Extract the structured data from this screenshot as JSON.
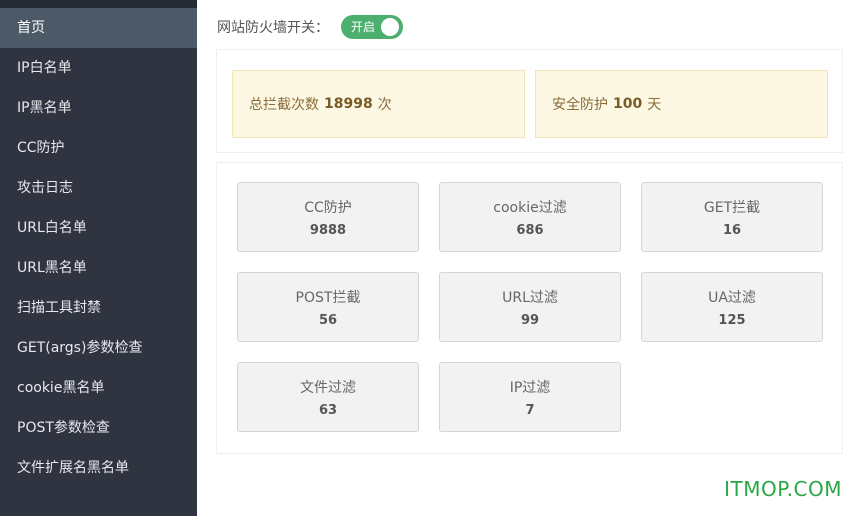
{
  "sidebar": {
    "items": [
      {
        "label": "首页",
        "active": true
      },
      {
        "label": "IP白名单"
      },
      {
        "label": "IP黑名单"
      },
      {
        "label": "CC防护"
      },
      {
        "label": "攻击日志"
      },
      {
        "label": "URL白名单"
      },
      {
        "label": "URL黑名单"
      },
      {
        "label": "扫描工具封禁"
      },
      {
        "label": "GET(args)参数检查"
      },
      {
        "label": "cookie黑名单"
      },
      {
        "label": "POST参数检查"
      },
      {
        "label": "文件扩展名黑名单"
      }
    ]
  },
  "firewall_switch": {
    "label": "网站防火墙开关：",
    "state_label": "开启",
    "on": true
  },
  "summary": {
    "total_intercept": {
      "prefix": "总拦截次数",
      "value": "18998",
      "suffix": "次"
    },
    "safe_days": {
      "prefix": "安全防护",
      "value": "100",
      "suffix": "天"
    }
  },
  "stats": [
    {
      "label": "CC防护",
      "value": "9888"
    },
    {
      "label": "cookie过滤",
      "value": "686"
    },
    {
      "label": "GET拦截",
      "value": "16"
    },
    {
      "label": "POST拦截",
      "value": "56"
    },
    {
      "label": "URL过滤",
      "value": "99"
    },
    {
      "label": "UA过滤",
      "value": "125"
    },
    {
      "label": "文件过滤",
      "value": "63"
    },
    {
      "label": "IP过滤",
      "value": "7"
    }
  ],
  "watermark": "ITMOP.COM",
  "colors": {
    "sidebar_bg": "#2f3440",
    "sidebar_active": "#4c5a68",
    "toggle_on": "#4caf6e",
    "summary_bg": "#fcf8e3",
    "watermark": "#2aa845"
  }
}
